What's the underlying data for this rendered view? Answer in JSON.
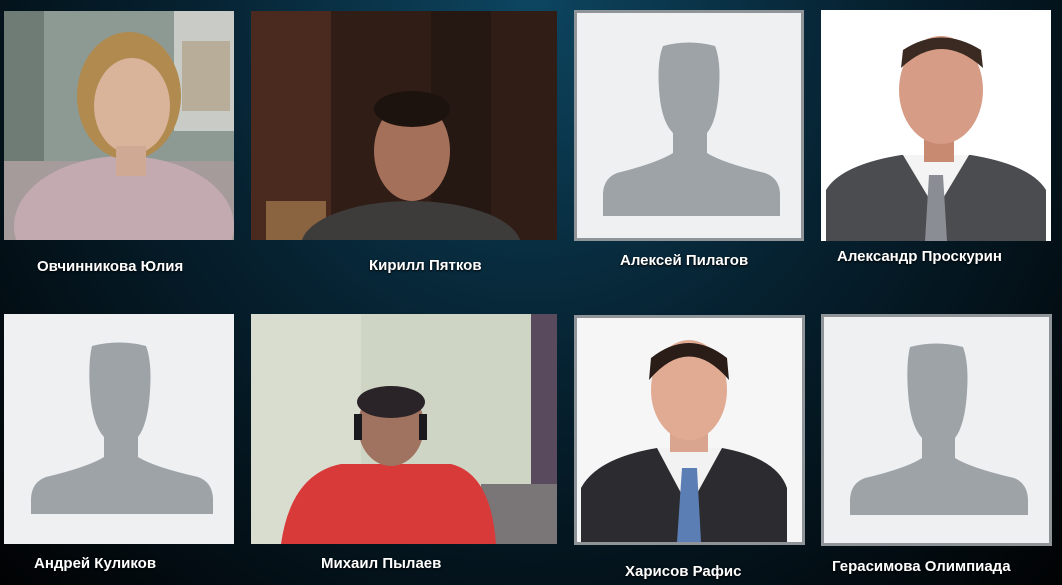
{
  "participants": [
    {
      "name": "Овчинникова Юлия",
      "photo": "video",
      "hangup_icon": "phone-hangup-icon"
    },
    {
      "name": "Кирилл Пятков",
      "photo": "video"
    },
    {
      "name": "Алексей Пилагов",
      "photo": "default-avatar"
    },
    {
      "name": "Александр Проскурин",
      "photo": "portrait"
    },
    {
      "name": "Андрей Куликов",
      "photo": "default-avatar"
    },
    {
      "name": "Михаил Пылаев",
      "photo": "video"
    },
    {
      "name": "Харисов Рафис",
      "photo": "portrait"
    },
    {
      "name": "Герасимова Олимпиада",
      "photo": "default-avatar"
    }
  ],
  "colors": {
    "background": "#062231",
    "avatar_silhouette": "#9ea3a8",
    "avatar_background": "#eef0f2",
    "name_text": "#ffffff"
  }
}
